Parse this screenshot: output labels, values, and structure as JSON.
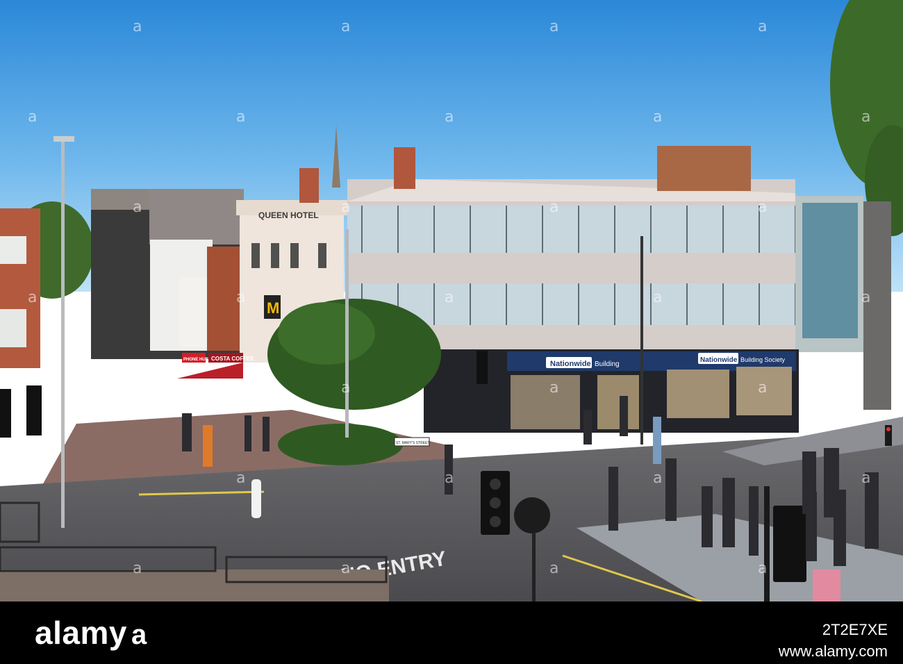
{
  "signs": {
    "queen_hotel": "QUEEN HOTEL",
    "mcdonalds": "M",
    "nationwide_1": "Nationwide",
    "nationwide_1_sub": "Building",
    "nationwide_2": "Nationwide",
    "nationwide_2_sub": "Building Society",
    "costa": "COSTA COFFEE",
    "phone_shop": "PHONE HUB",
    "street_sign": "ST. MARY'S STREET",
    "road_marking": "NO ENTRY"
  },
  "watermark": {
    "glyph": "a"
  },
  "footer": {
    "brand": "alamy",
    "brand_mark": "a",
    "image_id": "2T2E7XE",
    "site": "www.alamy.com"
  },
  "colors": {
    "sky_top": "#2f8fdc",
    "sky_bottom": "#bfe3f8",
    "nationwide_blue": "#1f3a6b",
    "costa_red": "#a4151f",
    "footer_bg": "#000000"
  }
}
